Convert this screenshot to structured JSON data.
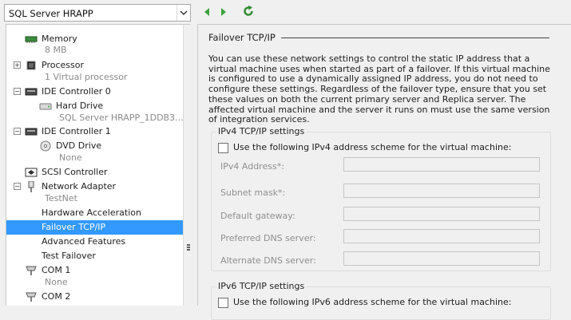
{
  "toolbar": {
    "vm_name": "SQL Server HRAPP",
    "back_icon": "back-arrow-icon",
    "forward_icon": "forward-arrow-icon",
    "refresh_icon": "refresh-icon"
  },
  "tree": {
    "items": [
      {
        "label": "Memory",
        "sub": "8 MB",
        "icon": "memory-icon"
      },
      {
        "label": "Processor",
        "sub": "1 Virtual processor",
        "icon": "processor-icon"
      },
      {
        "label": "IDE Controller 0",
        "icon": "ide-controller-icon"
      },
      {
        "label": "Hard Drive",
        "sub": "SQL Server HRAPP_1DDB3...",
        "icon": "hard-drive-icon"
      },
      {
        "label": "IDE Controller 1",
        "icon": "ide-controller-icon"
      },
      {
        "label": "DVD Drive",
        "sub": "None",
        "icon": "dvd-drive-icon"
      },
      {
        "label": "SCSI Controller",
        "icon": "scsi-controller-icon"
      },
      {
        "label": "Network Adapter",
        "sub": "TestNet",
        "icon": "network-adapter-icon"
      },
      {
        "label": "Hardware Acceleration"
      },
      {
        "label": "Failover TCP/IP"
      },
      {
        "label": "Advanced Features"
      },
      {
        "label": "Test Failover"
      },
      {
        "label": "COM 1",
        "sub": "None",
        "icon": "com-port-icon"
      },
      {
        "label": "COM 2",
        "icon": "com-port-icon"
      }
    ],
    "selected": "Failover TCP/IP"
  },
  "panel": {
    "title": "Failover TCP/IP",
    "description": "You can use these network settings to control the static IP address that a virtual machine uses when started as part of a failover. If this virtual machine is configured to use a dynamically assigned IP address, you do not need to configure these settings. Regardless of the failover type, ensure that you set these values on both the current primary server and Replica server. The affected virtual machine and the server it runs on must use the same version of integration services.",
    "ipv4": {
      "group_title": "IPv4 TCP/IP settings",
      "checkbox_label": "Use the following IPv4 address scheme for the virtual machine:",
      "checked": false,
      "fields": [
        {
          "label": "IPv4 Address*:",
          "value": ""
        },
        {
          "label": "Subnet mask*:",
          "value": ""
        },
        {
          "label": "Default gateway:",
          "value": ""
        },
        {
          "label": "Preferred DNS server:",
          "value": ""
        },
        {
          "label": "Alternate DNS server:",
          "value": ""
        }
      ]
    },
    "ipv6": {
      "group_title": "IPv6 TCP/IP settings",
      "checkbox_label": "Use the following IPv6 address scheme for the virtual machine:",
      "checked": false
    }
  },
  "colors": {
    "selection": "#3399ff",
    "nav_arrow": "#3aa03a",
    "disabled_text": "#8f8f8f"
  }
}
